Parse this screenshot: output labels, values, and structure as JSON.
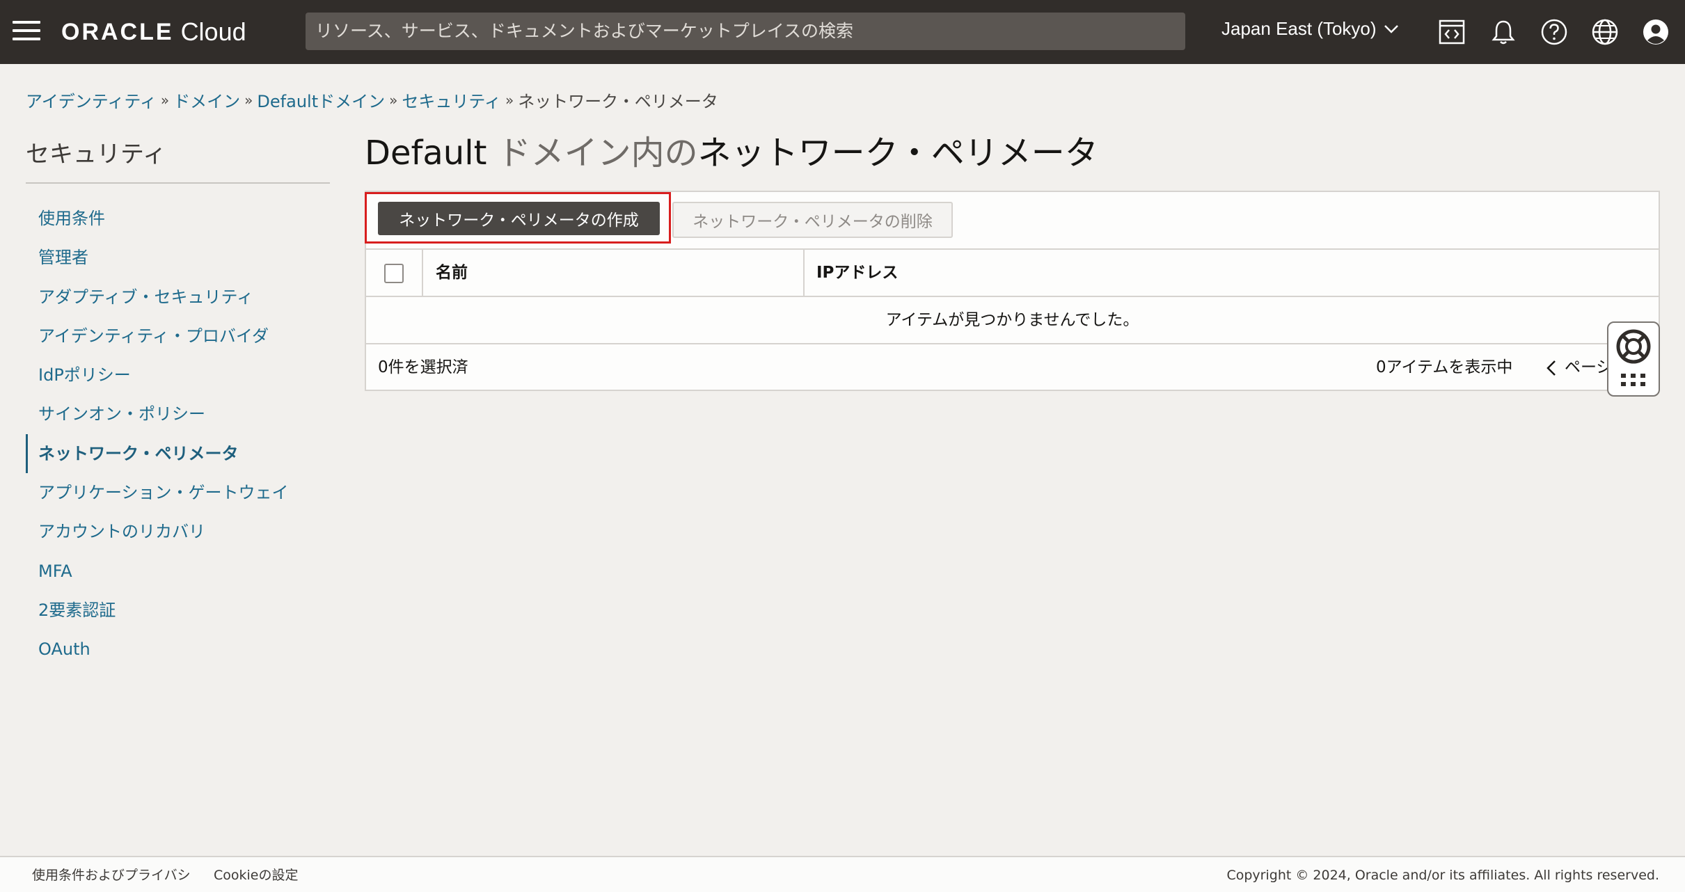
{
  "header": {
    "brand_word": "ORACLE",
    "brand_product": "Cloud",
    "search_placeholder": "リソース、サービス、ドキュメントおよびマーケットプレイスの検索",
    "region": "Japan East (Tokyo)",
    "icons": [
      "menu-icon",
      "code-editor-icon",
      "bell-icon",
      "help-icon",
      "globe-icon",
      "user-icon"
    ]
  },
  "breadcrumb": {
    "items": [
      "アイデンティティ",
      "ドメイン",
      "Defaultドメイン",
      "セキュリティ"
    ],
    "current": "ネットワーク・ペリメータ",
    "separator": "»"
  },
  "sidebar": {
    "title": "セキュリティ",
    "items": [
      {
        "label": "使用条件"
      },
      {
        "label": "管理者"
      },
      {
        "label": "アダプティブ・セキュリティ"
      },
      {
        "label": "アイデンティティ・プロバイダ"
      },
      {
        "label": "IdPポリシー"
      },
      {
        "label": "サインオン・ポリシー"
      },
      {
        "label": "ネットワーク・ペリメータ",
        "active": true
      },
      {
        "label": "アプリケーション・ゲートウェイ"
      },
      {
        "label": "アカウントのリカバリ"
      },
      {
        "label": "MFA"
      },
      {
        "label": "2要素認証"
      },
      {
        "label": "OAuth"
      }
    ]
  },
  "main": {
    "title_prefix": "Default",
    "title_middle": " ドメイン内の",
    "title_suffix": "ネットワーク・ペリメータ",
    "create_button": "ネットワーク・ペリメータの作成",
    "delete_button": "ネットワーク・ペリメータの削除",
    "table": {
      "columns": [
        "名前",
        "IPアドレス"
      ],
      "empty_message": "アイテムが見つかりませんでした。",
      "selected_count": "0件を選択済",
      "showing": "0アイテムを表示中",
      "page_label": "ページ"
    }
  },
  "footer": {
    "terms_link": "使用条件およびプライバシ",
    "cookie_link": "Cookieの設定",
    "copyright": "Copyright © 2024, Oracle and/or its affiliates. All rights reserved."
  },
  "colors": {
    "header_bg": "#312d2a",
    "link": "#1e6a8c",
    "primary_button": "#4a4744",
    "highlight_border": "#d81e1e"
  }
}
